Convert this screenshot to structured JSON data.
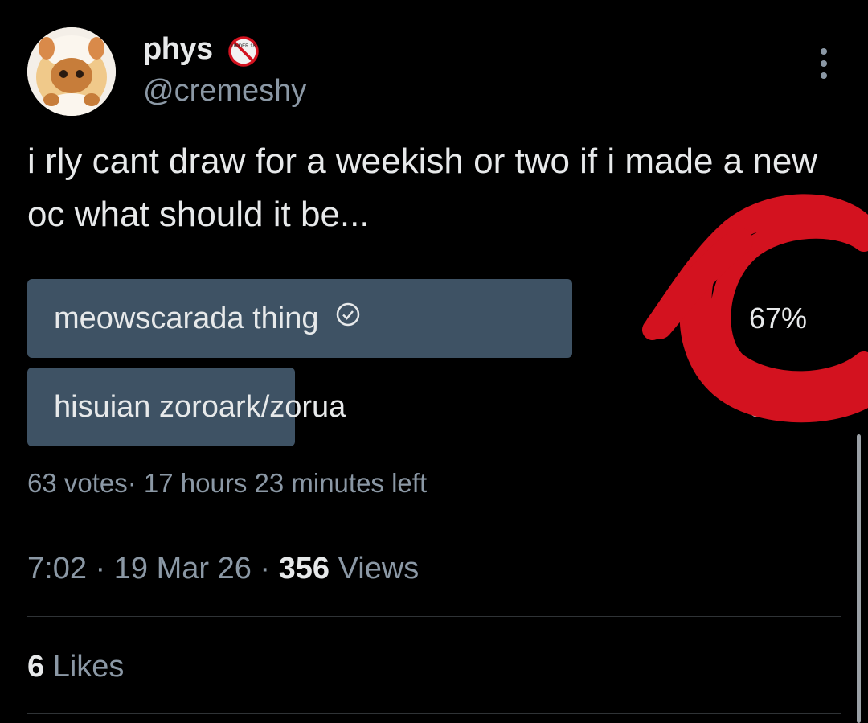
{
  "tweet": {
    "display_name": "phys",
    "badge_text": "UNDER 18",
    "handle": "@cremeshy",
    "text": "i rly cant draw for a weekish or two if i made a new oc what should it be...",
    "poll": {
      "options": [
        {
          "label": "meowscarada thing",
          "percent_text": "67%",
          "fraction": 0.67,
          "selected": true
        },
        {
          "label": "hisuian zoroark/zorua",
          "percent_text": "33%",
          "fraction": 0.33,
          "selected": false
        }
      ],
      "votes_text": "63 votes",
      "time_left_text": "17 hours 23 minutes left"
    },
    "time": "7:02",
    "date": "19 Mar 26",
    "views_count": "356",
    "views_label": "Views",
    "likes_count": "6",
    "likes_label": "Likes"
  },
  "colors": {
    "background": "#000000",
    "poll_fill": "#3e5264",
    "annotation": "#d3121f"
  },
  "icons": [
    "avatar-eevee-plush",
    "under-18-badge-icon",
    "more-options-icon",
    "check-circle-icon"
  ]
}
